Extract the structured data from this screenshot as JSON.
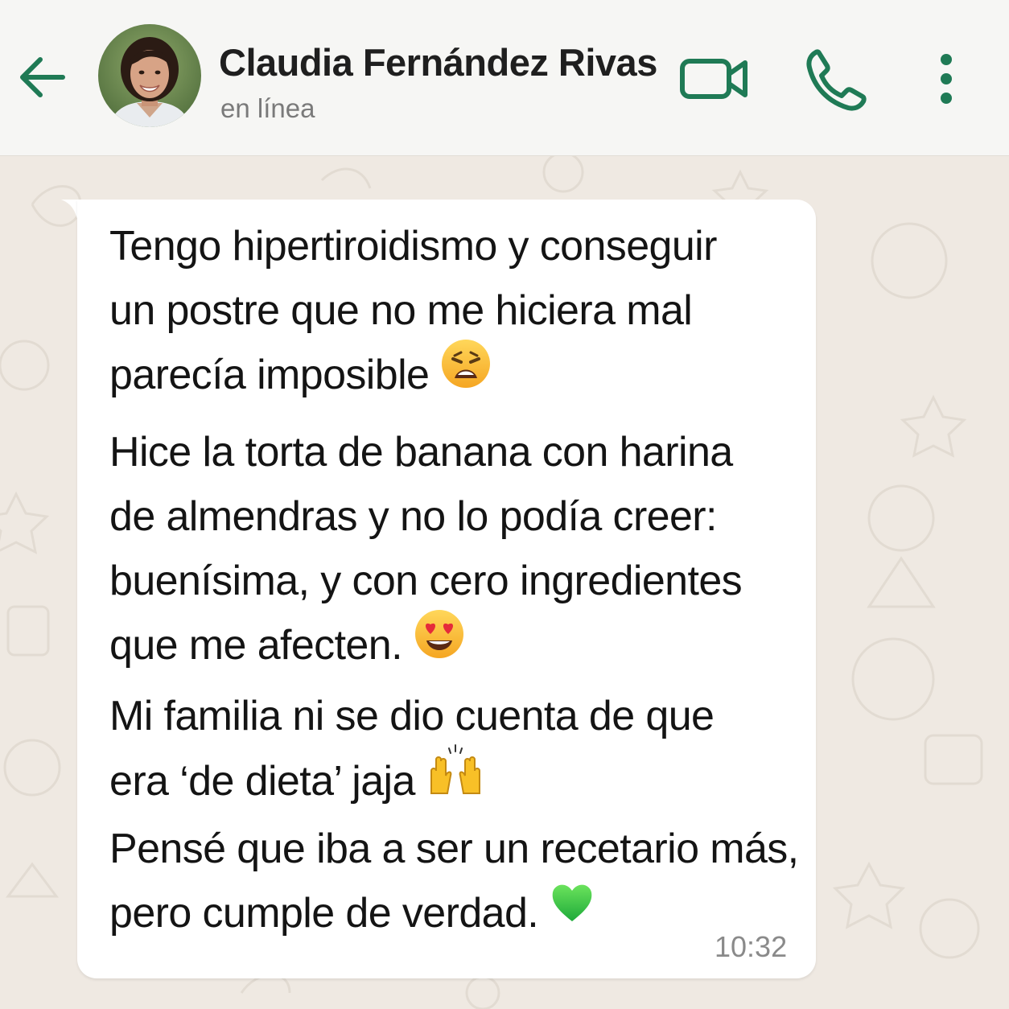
{
  "header": {
    "contact_name": "Claudia Fernández Rivas",
    "status": "en línea",
    "icons": [
      "arrow-left-icon",
      "video-camera-icon",
      "phone-icon",
      "more-vertical-icon"
    ]
  },
  "message": {
    "paragraphs": [
      {
        "lines": [
          "Tengo hipertiroidismo y conseguir",
          "un postre que no me hiciera mal",
          "parecía imposible"
        ],
        "emoji": "weary-face"
      },
      {
        "lines": [
          "Hice la torta de banana con harina",
          "de almendras y no lo podía creer:",
          "buenísima, y con cero ingredientes",
          "que me afecten."
        ],
        "emoji": "heart-eyes"
      },
      {
        "lines": [
          "Mi familia ni se dio cuenta de que",
          "era ‘de dieta’ jaja"
        ],
        "emoji": "raising-hands"
      },
      {
        "lines": [
          "Pensé que iba a ser un recetario más,",
          "pero cumple de verdad."
        ],
        "emoji": "green-heart"
      }
    ],
    "time": "10:32"
  },
  "colors": {
    "accent": "#1f7a55",
    "header_bg": "#f6f6f4",
    "chat_bg": "#efe9e2",
    "bubble_bg": "#ffffff"
  }
}
